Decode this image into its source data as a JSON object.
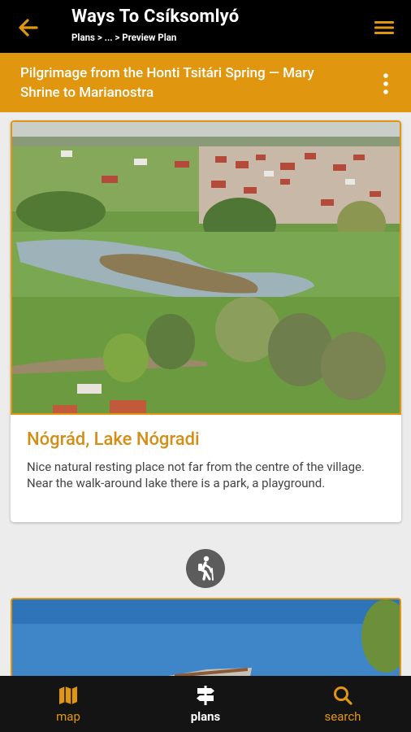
{
  "appbar": {
    "title": "Ways To Csíksomlyó",
    "breadcrumb": "Plans > ... > Preview Plan"
  },
  "plan": {
    "title": "Pilgrimage from the Honti Tsitári Spring — Mary Shrine to Marianostra"
  },
  "waypoint": {
    "title": "Nógrád, Lake Nógradi",
    "description": "Nice natural resting place not far from the centre of the village. Near the walk-around lake there is a park, a playground."
  },
  "bottom_nav": {
    "map": "map",
    "plans": "plans",
    "search": "search"
  },
  "colors": {
    "accent": "#e0960f",
    "appbar": "#000000",
    "bottom_nav": "#141414"
  }
}
